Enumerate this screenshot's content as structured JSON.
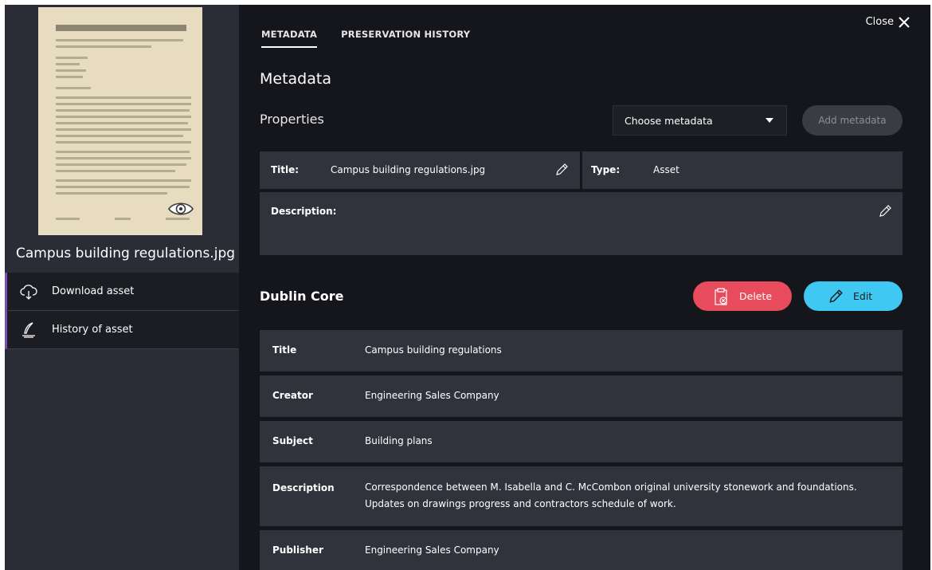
{
  "sidebar": {
    "asset_name": "Campus building regulations.jpg",
    "items": [
      {
        "label": "Download asset",
        "icon": "cloud-download-icon"
      },
      {
        "label": "History of asset",
        "icon": "quill-pen-icon"
      }
    ]
  },
  "tabs": [
    {
      "label": "METADATA",
      "active": true
    },
    {
      "label": "PRESERVATION HISTORY",
      "active": false
    }
  ],
  "close_label": "Close",
  "metadata_heading": "Metadata",
  "properties": {
    "heading": "Properties",
    "select_value": "Choose metadata",
    "add_label": "Add metadata",
    "title_label": "Title:",
    "title_value": "Campus building regulations.jpg",
    "type_label": "Type:",
    "type_value": "Asset",
    "description_label": "Description:"
  },
  "dublin_core": {
    "heading": "Dublin Core",
    "delete_label": "Delete",
    "edit_label": "Edit",
    "rows": [
      {
        "label": "Title",
        "value": "Campus building regulations"
      },
      {
        "label": "Creator",
        "value": "Engineering Sales Company"
      },
      {
        "label": "Subject",
        "value": "Building plans"
      },
      {
        "label": "Description",
        "value": "Correspondence between M. Isabella and C. McCombon original university stonework and foundations. Updates on drawings progress and contractors schedule of work."
      },
      {
        "label": "Publisher",
        "value": "Engineering Sales Company"
      }
    ]
  },
  "colors": {
    "background": "#15161b",
    "sidebar": "#2a2d35",
    "card": "#30333c",
    "delete": "#e84c5c",
    "edit": "#3fc8f2",
    "accent": "#7b4fb8"
  }
}
